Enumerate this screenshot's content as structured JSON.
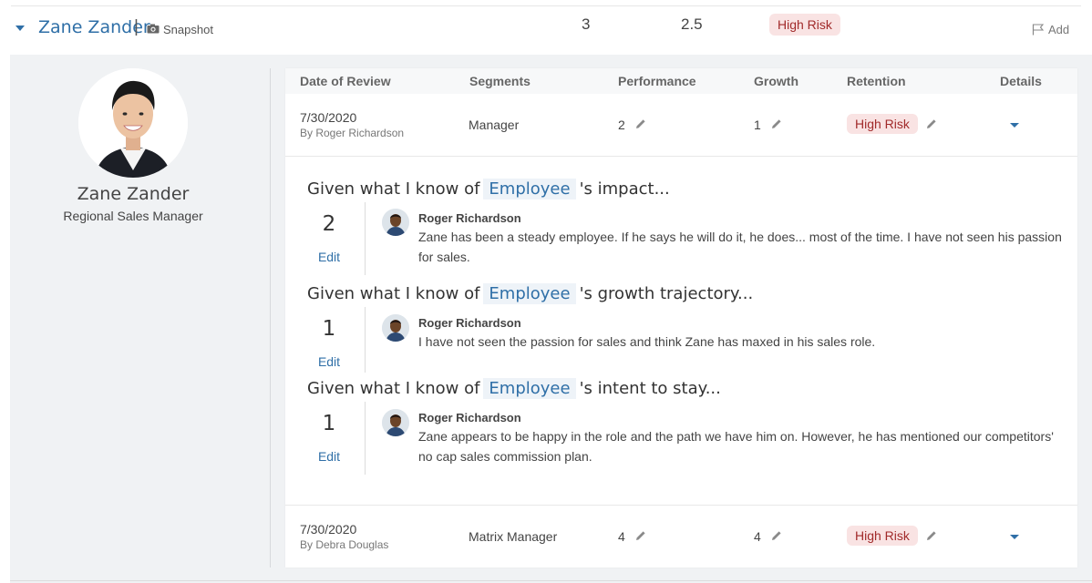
{
  "header": {
    "name": "Zane Zander",
    "separator": "|",
    "snapshot_label": "Snapshot",
    "value_1": "3",
    "value_2": "2.5",
    "risk_badge": "High Risk",
    "add_label": "Add"
  },
  "profile": {
    "name": "Zane Zander",
    "title": "Regional Sales Manager"
  },
  "table": {
    "columns": [
      "Date of Review",
      "Segments",
      "Performance",
      "Growth",
      "Retention",
      "Details"
    ],
    "rows": [
      {
        "date": "7/30/2020",
        "by": "By Roger Richardson",
        "segment": "Manager",
        "performance": "2",
        "growth": "1",
        "retention": "High Risk"
      },
      {
        "date": "7/30/2020",
        "by": "By Debra Douglas",
        "segment": "Matrix Manager",
        "performance": "4",
        "growth": "4",
        "retention": "High Risk"
      }
    ]
  },
  "questions": [
    {
      "prefix": "Given what I know of",
      "token": "Employee",
      "suffix": "'s impact...",
      "score": "2",
      "edit": "Edit",
      "reviewer": "Roger Richardson",
      "comment": "Zane has been a steady employee. If he says he will do it, he does... most of the time. I have not seen his passion for sales."
    },
    {
      "prefix": "Given what I know of",
      "token": "Employee",
      "suffix": "'s growth trajectory...",
      "score": "1",
      "edit": "Edit",
      "reviewer": "Roger Richardson",
      "comment": "I have not seen the passion for sales and think Zane has maxed in his sales role."
    },
    {
      "prefix": "Given what I know of",
      "token": "Employee",
      "suffix": "'s intent to stay...",
      "score": "1",
      "edit": "Edit",
      "reviewer": "Roger Richardson",
      "comment": "Zane appears to be happy in the role and the path we have him on. However, he has mentioned our competitors' no cap sales commission plan."
    }
  ],
  "colors": {
    "accent": "#2f6fa7",
    "risk_bg": "#f9e3e3",
    "risk_text": "#a12a2a",
    "panel_bg": "#f0f2f4"
  },
  "icons": [
    "chevron-down-icon",
    "camera-icon",
    "flag-icon",
    "pencil-icon"
  ]
}
